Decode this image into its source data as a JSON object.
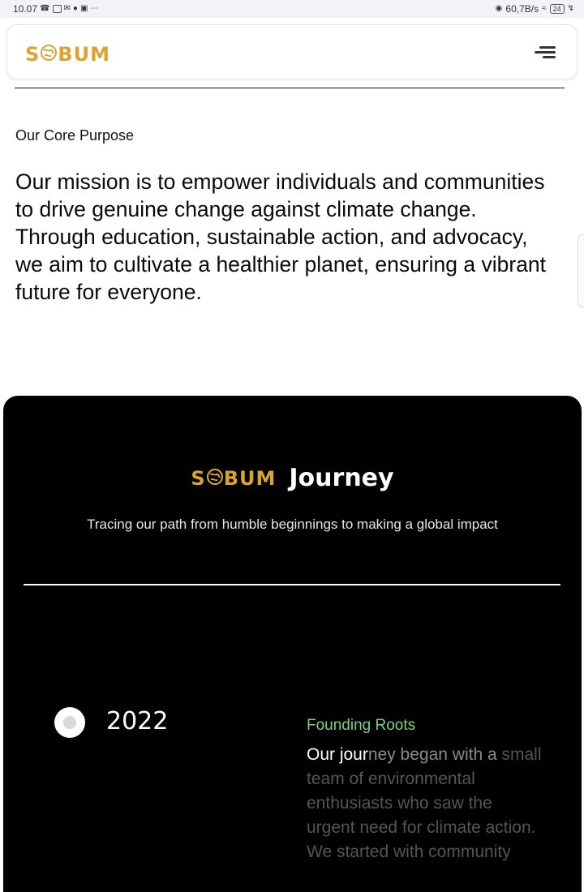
{
  "status_bar": {
    "time": "10.07",
    "speed": "60,7B/s",
    "battery": "24"
  },
  "header": {
    "logo_part1": "S",
    "logo_part2": "BUM",
    "menu_icon": "hamburger-menu-icon"
  },
  "purpose": {
    "label": "Our Core Purpose",
    "mission": "Our mission is to empower individuals and communities to drive genuine change against climate change. Through education, sustainable action, and advocacy, we aim to cultivate a healthier planet, ensuring a vibrant future for everyone."
  },
  "journey": {
    "logo_part1": "S",
    "logo_part2": "BUM",
    "title": "Journey",
    "subtitle": "Tracing our path from humble beginnings to making a global impact",
    "timeline": [
      {
        "year": "2022",
        "title": "Founding Roots",
        "body_highlight": "Our jour",
        "body_mid": "ney began with a",
        "body_rest": " small team of environmental enthusiasts who saw the urgent need for climate action. We started with community"
      }
    ]
  },
  "colors": {
    "brand_gold": "#d9a530",
    "accent_green": "#7ed07e",
    "dark_bg": "#000000"
  }
}
